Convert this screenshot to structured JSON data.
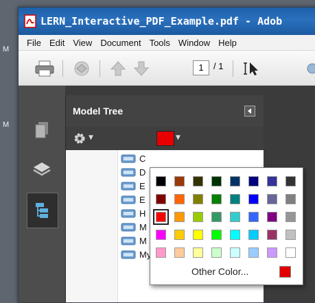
{
  "desktop": {
    "label_top": "M",
    "label_bottom": "M"
  },
  "window": {
    "title": "LERN_Interactive_PDF_Example.pdf - Adob"
  },
  "menu": [
    "File",
    "Edit",
    "View",
    "Document",
    "Tools",
    "Window",
    "Help"
  ],
  "toolbar": {
    "page_current": "1",
    "page_total": "/ 1"
  },
  "panel": {
    "title": "Model Tree"
  },
  "tree": {
    "nodes": [
      "C",
      "D",
      "E",
      "E",
      "H",
      "M",
      "M",
      "Mythimna comma"
    ]
  },
  "colors": {
    "selected": "#e80000"
  },
  "palette": {
    "rows": [
      [
        "#000000",
        "#9a3a08",
        "#333300",
        "#003300",
        "#003366",
        "#000080",
        "#333399",
        "#333333"
      ],
      [
        "#800000",
        "#ff6600",
        "#808000",
        "#008000",
        "#008080",
        "#0000ff",
        "#666699",
        "#808080"
      ],
      [
        "#ff0000",
        "#ff9900",
        "#99cc00",
        "#339966",
        "#33cccc",
        "#3366ff",
        "#800080",
        "#969696"
      ],
      [
        "#ff00ff",
        "#ffcc00",
        "#ffff00",
        "#00ff00",
        "#00ffff",
        "#00ccff",
        "#993366",
        "#c0c0c0"
      ],
      [
        "#ff99cc",
        "#ffcc99",
        "#ffff99",
        "#ccffcc",
        "#ccffff",
        "#99ccff",
        "#cc99ff",
        "#ffffff"
      ]
    ],
    "other_label": "Other Color...",
    "other_color": "#e00000"
  }
}
